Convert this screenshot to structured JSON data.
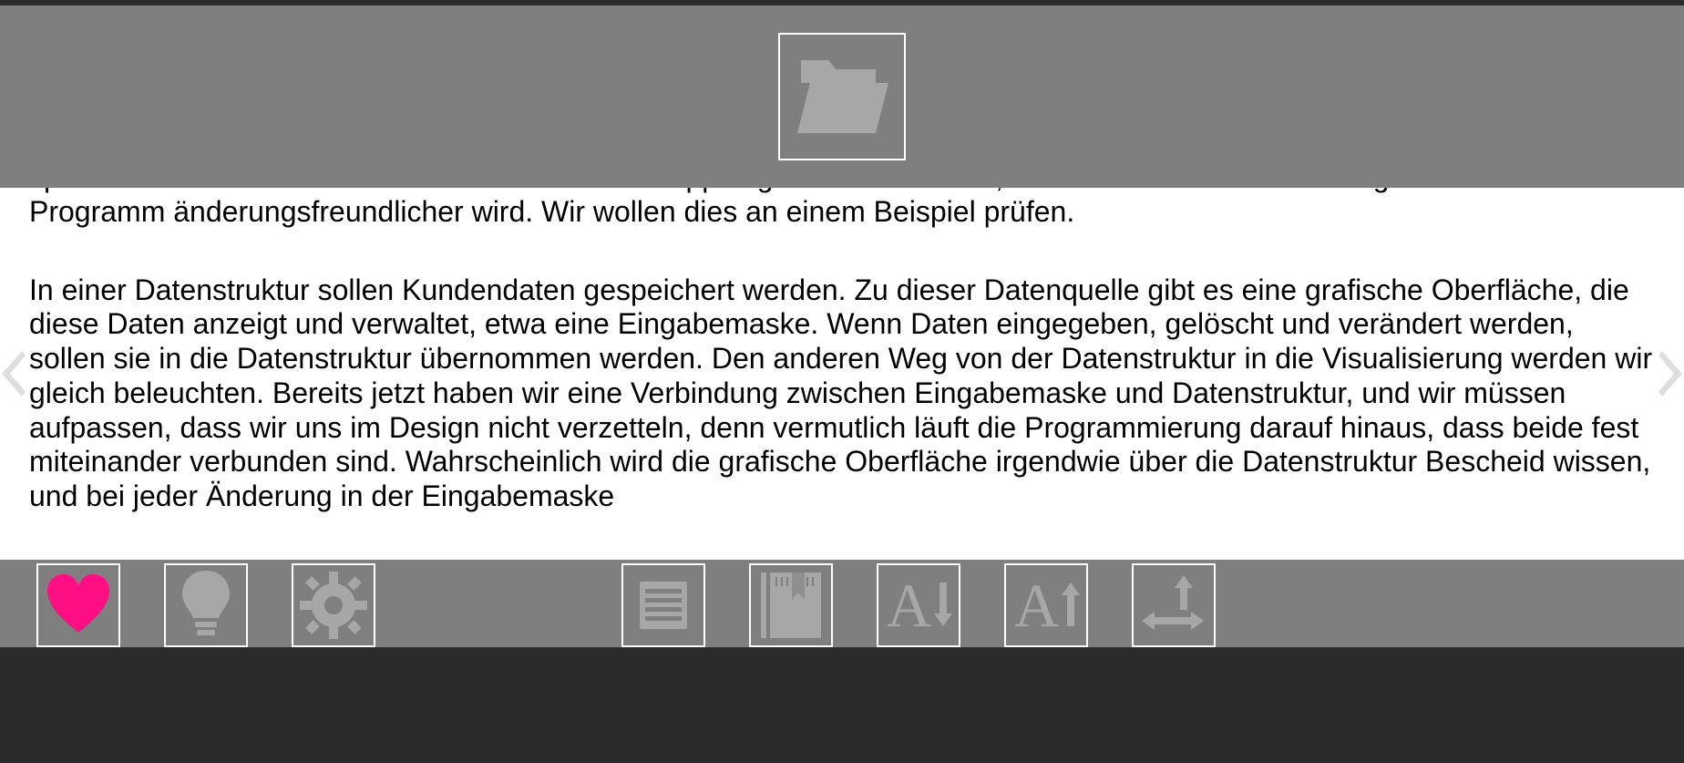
{
  "content": {
    "paragraph1": "später noch verändert werden können. Die lose Kopplung hat viele Vorteile, da so die Wiederverwendung erhöht und das Programm änderungsfreundlicher wird. Wir wollen dies an einem Beispiel prüfen.",
    "paragraph2": "In einer Datenstruktur sollen Kundendaten gespeichert werden. Zu dieser Datenquelle gibt es eine grafische Oberfläche, die diese Daten anzeigt und verwaltet, etwa eine Eingabemaske. Wenn Daten eingegeben, gelöscht und verändert werden, sollen sie in die Datenstruktur übernommen werden. Den anderen Weg von der Datenstruktur in die Visualisierung werden wir gleich beleuchten. Bereits jetzt haben wir eine Verbindung zwischen Eingabemaske und Datenstruktur, und wir müssen aufpassen, dass wir uns im Design nicht verzetteln, denn vermutlich läuft die Programmierung darauf hinaus, dass beide fest miteinander verbunden sind. Wahrscheinlich wird die grafische Oberfläche irgendwie über die Datenstruktur Bescheid wissen, und bei jeder Änderung in der Eingabemaske"
  },
  "toolbar": {
    "open": "Open",
    "favorite": "Favorite",
    "lightbulb": "Tip",
    "settings": "Settings",
    "toc": "Contents",
    "bookmark": "Bookmark",
    "font_decrease": "Decrease font",
    "font_increase": "Increase font",
    "fit": "Fit"
  },
  "colors": {
    "accent_heart": "#ff0e84",
    "bars": "#7f7f7f",
    "icon": "#a7a7a7"
  }
}
